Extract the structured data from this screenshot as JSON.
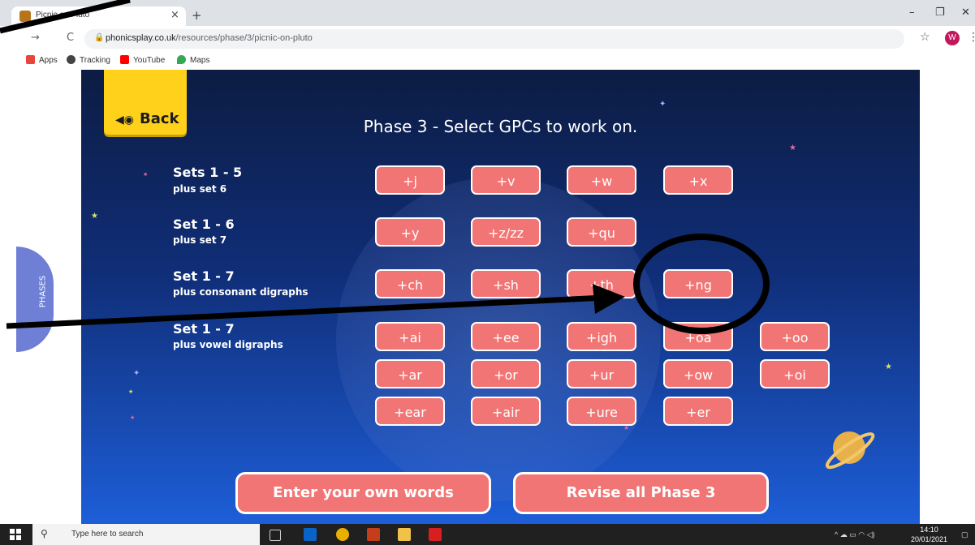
{
  "browser": {
    "tab_title": "Picnic on Pluto",
    "tab_close": "×",
    "new_tab": "+",
    "window_controls": [
      "–",
      "❐",
      "✕"
    ],
    "nav": {
      "back": "←",
      "forward": "→",
      "reload": "C"
    },
    "url_host": "phonicsplay.co.uk",
    "url_path": "/resources/phase/3/picnic-on-pluto",
    "profile_initial": "W",
    "bookmarks": [
      {
        "label": "Apps",
        "icon": "apps-grid-icon",
        "color": "#e8453c"
      },
      {
        "label": "Tracking",
        "icon": "globe-icon",
        "color": "#444444"
      },
      {
        "label": "YouTube",
        "icon": "youtube-icon",
        "color": "#ff0000"
      },
      {
        "label": "Maps",
        "icon": "maps-pin-icon",
        "color": "#34a853"
      }
    ]
  },
  "game": {
    "back_label": "Back",
    "title": "Phase 3 - Select GPCs to work on.",
    "phases_label": "PHASES",
    "sets": [
      {
        "heading": "Sets 1 - 5",
        "sub": "plus set 6"
      },
      {
        "heading": "Set 1 - 6",
        "sub": "plus set 7"
      },
      {
        "heading": "Set 1 - 7",
        "sub": "plus consonant digraphs"
      },
      {
        "heading": "Set 1 - 7",
        "sub": "plus vowel digraphs"
      }
    ],
    "gpcs": {
      "row1": [
        "+j",
        "+v",
        "+w",
        "+x"
      ],
      "row2": [
        "+y",
        "+z/zz",
        "+qu"
      ],
      "row3": [
        "+ch",
        "+sh",
        "+th",
        "+ng"
      ],
      "row4": [
        "+ai",
        "+ee",
        "+igh",
        "+oa",
        "+oo"
      ],
      "row5": [
        "+ar",
        "+or",
        "+ur",
        "+ow",
        "+oi"
      ],
      "row6": [
        "+ear",
        "+air",
        "+ure",
        "+er"
      ]
    },
    "enter_words": "Enter your own words",
    "revise_all": "Revise all Phase 3",
    "colors": {
      "accent_button": "#f27575",
      "back_button": "#ffd11a",
      "phases_tab": "#6f7fd6"
    }
  },
  "taskbar": {
    "search_placeholder": "Type here to search",
    "time": "14:10",
    "date": "20/01/2021"
  }
}
